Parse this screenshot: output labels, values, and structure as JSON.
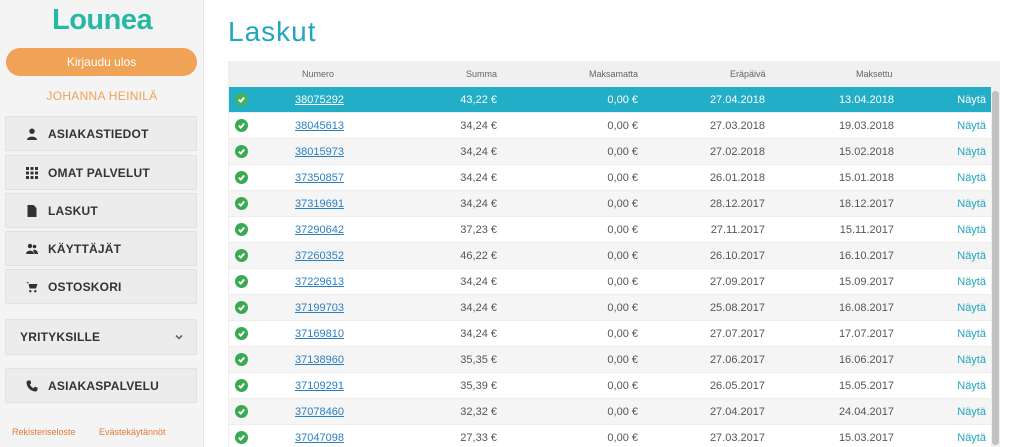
{
  "sidebar": {
    "logo": "Lounea",
    "logout_label": "Kirjaudu ulos",
    "user_name": "JOHANNA HEINILÄ",
    "nav": [
      {
        "label": "ASIAKASTIEDOT",
        "icon": "person-icon"
      },
      {
        "label": "OMAT PALVELUT",
        "icon": "grid-icon"
      },
      {
        "label": "LASKUT",
        "icon": "document-icon"
      },
      {
        "label": "KÄYTTÄJÄT",
        "icon": "users-icon"
      },
      {
        "label": "OSTOSKORI",
        "icon": "cart-icon"
      }
    ],
    "companies_label": "YRITYKSILLE",
    "support_label": "ASIAKASPALVELU",
    "footer": {
      "privacy": "Rekisteriseloste",
      "cookies": "Evästekäytännöt"
    }
  },
  "main": {
    "title": "Laskut",
    "columns": {
      "number": "Numero",
      "sum": "Summa",
      "unpaid": "Maksamatta",
      "due": "Eräpäivä",
      "paid": "Maksettu"
    },
    "show_label": "Näytä",
    "rows": [
      {
        "number": "38075292",
        "sum": "43,22 €",
        "unpaid": "0,00 €",
        "due": "27.04.2018",
        "paid": "13.04.2018"
      },
      {
        "number": "38045613",
        "sum": "34,24 €",
        "unpaid": "0,00 €",
        "due": "27.03.2018",
        "paid": "19.03.2018"
      },
      {
        "number": "38015973",
        "sum": "34,24 €",
        "unpaid": "0,00 €",
        "due": "27.02.2018",
        "paid": "15.02.2018"
      },
      {
        "number": "37350857",
        "sum": "34,24 €",
        "unpaid": "0,00 €",
        "due": "26.01.2018",
        "paid": "15.01.2018"
      },
      {
        "number": "37319691",
        "sum": "34,24 €",
        "unpaid": "0,00 €",
        "due": "28.12.2017",
        "paid": "18.12.2017"
      },
      {
        "number": "37290642",
        "sum": "37,23 €",
        "unpaid": "0,00 €",
        "due": "27.11.2017",
        "paid": "15.11.2017"
      },
      {
        "number": "37260352",
        "sum": "46,22 €",
        "unpaid": "0,00 €",
        "due": "26.10.2017",
        "paid": "16.10.2017"
      },
      {
        "number": "37229613",
        "sum": "34,24 €",
        "unpaid": "0,00 €",
        "due": "27.09.2017",
        "paid": "15.09.2017"
      },
      {
        "number": "37199703",
        "sum": "34,24 €",
        "unpaid": "0,00 €",
        "due": "25.08.2017",
        "paid": "16.08.2017"
      },
      {
        "number": "37169810",
        "sum": "34,24 €",
        "unpaid": "0,00 €",
        "due": "27.07.2017",
        "paid": "17.07.2017"
      },
      {
        "number": "37138960",
        "sum": "35,35 €",
        "unpaid": "0,00 €",
        "due": "27.06.2017",
        "paid": "16.06.2017"
      },
      {
        "number": "37109291",
        "sum": "35,39 €",
        "unpaid": "0,00 €",
        "due": "26.05.2017",
        "paid": "15.05.2017"
      },
      {
        "number": "37078460",
        "sum": "32,32 €",
        "unpaid": "0,00 €",
        "due": "27.04.2017",
        "paid": "24.04.2017"
      },
      {
        "number": "37047098",
        "sum": "27,33 €",
        "unpaid": "0,00 €",
        "due": "27.03.2017",
        "paid": "15.03.2017"
      }
    ]
  },
  "colors": {
    "brand_teal": "#27b8a4",
    "accent_orange": "#f0a257",
    "title_blue": "#1fa6c0",
    "active_row": "#21aec6",
    "paid_check": "#3aaa52"
  }
}
